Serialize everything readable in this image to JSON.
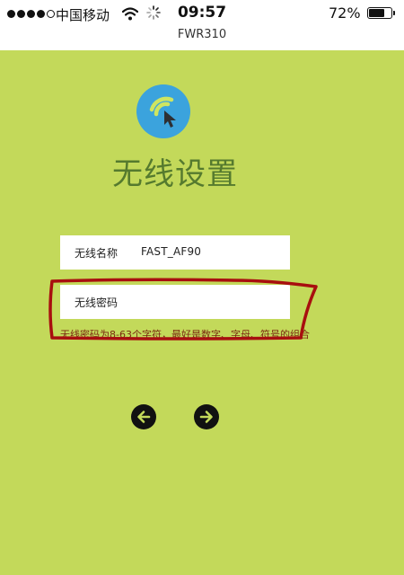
{
  "status_bar": {
    "carrier": "中国移动",
    "time": "09:57",
    "battery_percent": "72%",
    "battery_level": 0.72,
    "signal_bars": 4,
    "icons": [
      "signal-dots-icon",
      "wifi-icon",
      "loading-spinner-icon",
      "battery-icon"
    ]
  },
  "header": {
    "title": "FWR310"
  },
  "logo": {
    "icon": "wifi-cursor-icon",
    "color": "#3ba3dd"
  },
  "page": {
    "title": "无线设置"
  },
  "form": {
    "ssid_label": "无线名称",
    "ssid_value": "FAST_AF90",
    "password_label": "无线密码",
    "password_value": "",
    "hint": "无线密码为8-63个字符，最好是数字、字母、符号的组合"
  },
  "nav": {
    "prev_icon": "arrow-left-icon",
    "next_icon": "arrow-right-icon"
  },
  "colors": {
    "background": "#c3d95a",
    "title_text": "#557a2e",
    "annotation": "#a80f0f"
  }
}
